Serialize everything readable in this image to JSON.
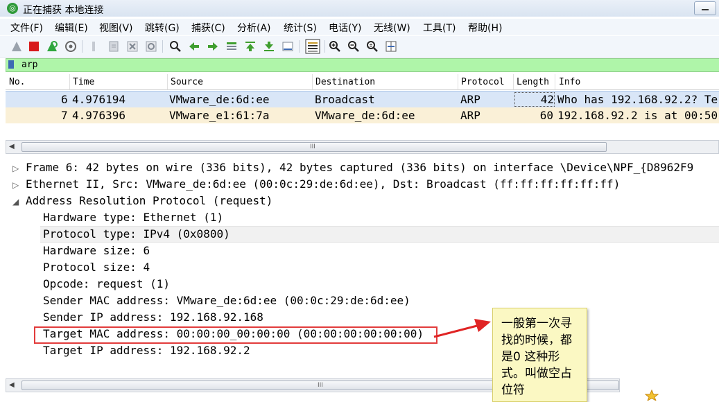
{
  "window": {
    "title": "正在捕获 本地连接"
  },
  "menu": [
    "文件(F)",
    "编辑(E)",
    "视图(V)",
    "跳转(G)",
    "捕获(C)",
    "分析(A)",
    "统计(S)",
    "电话(Y)",
    "无线(W)",
    "工具(T)",
    "帮助(H)"
  ],
  "filter": {
    "value": "arp"
  },
  "packet_list": {
    "columns": [
      "No.",
      "Time",
      "Source",
      "Destination",
      "Protocol",
      "Length",
      "Info"
    ],
    "rows": [
      {
        "no": "6",
        "time": "4.976194",
        "source": "VMware_de:6d:ee",
        "destination": "Broadcast",
        "protocol": "ARP",
        "length": "42",
        "info": "Who has 192.168.92.2? Te"
      },
      {
        "no": "7",
        "time": "4.976396",
        "source": "VMware_e1:61:7a",
        "destination": "VMware_de:6d:ee",
        "protocol": "ARP",
        "length": "60",
        "info": "192.168.92.2 is at 00:50"
      }
    ]
  },
  "details": {
    "frame": "Frame 6: 42 bytes on wire (336 bits), 42 bytes captured (336 bits) on interface \\Device\\NPF_{D8962F9",
    "ethernet": "Ethernet II, Src: VMware_de:6d:ee (00:0c:29:de:6d:ee), Dst: Broadcast (ff:ff:ff:ff:ff:ff)",
    "arp": "Address Resolution Protocol (request)",
    "fields": [
      "Hardware type: Ethernet (1)",
      "Protocol type: IPv4 (0x0800)",
      "Hardware size: 6",
      "Protocol size: 4",
      "Opcode: request (1)",
      "Sender MAC address: VMware_de:6d:ee (00:0c:29:de:6d:ee)",
      "Sender IP address: 192.168.92.168",
      "Target MAC address: 00:00:00_00:00:00 (00:00:00:00:00:00)",
      "Target IP address: 192.168.92.2"
    ]
  },
  "note": {
    "text": "一般第一次寻找的时候，都是0 这种形式。叫做空占位符"
  },
  "scroll_grip": "III"
}
